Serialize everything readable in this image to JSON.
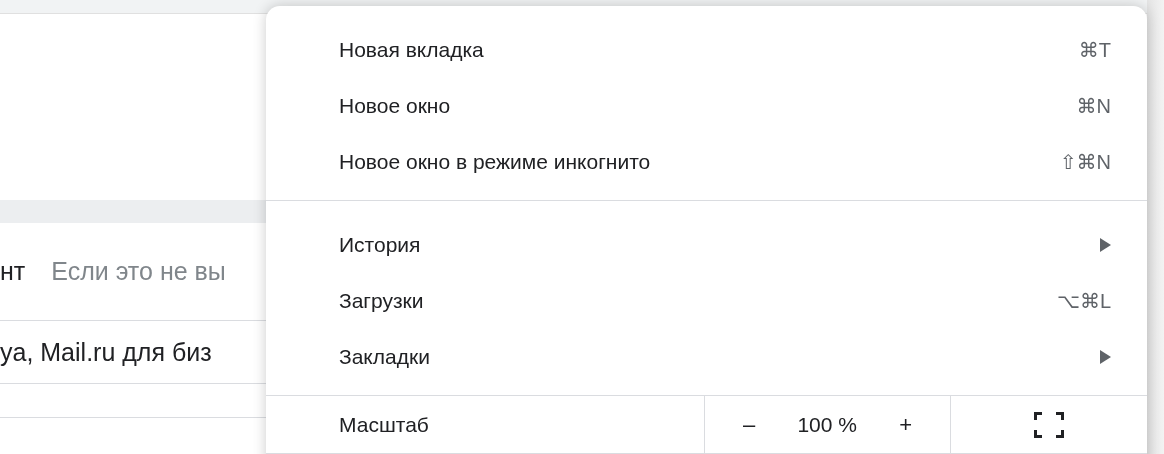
{
  "page": {
    "rows": [
      {
        "title": "нт",
        "snippet": "Если это не вы"
      },
      {
        "title": "ya, Mail.ru для биз"
      }
    ]
  },
  "menu": {
    "groups": [
      [
        {
          "label": "Новая вкладка",
          "kind": "shortcut",
          "shortcut": "⌘T"
        },
        {
          "label": "Новое окно",
          "kind": "shortcut",
          "shortcut": "⌘N"
        },
        {
          "label": "Новое окно в режиме инкогнито",
          "kind": "shortcut",
          "shortcut": "⇧⌘N"
        }
      ],
      [
        {
          "label": "История",
          "kind": "submenu"
        },
        {
          "label": "Загрузки",
          "kind": "shortcut",
          "shortcut": "⌥⌘L"
        },
        {
          "label": "Закладки",
          "kind": "submenu"
        }
      ]
    ],
    "zoom": {
      "label": "Масштаб",
      "decrease": "–",
      "value": "100 %",
      "increase": "+"
    }
  }
}
